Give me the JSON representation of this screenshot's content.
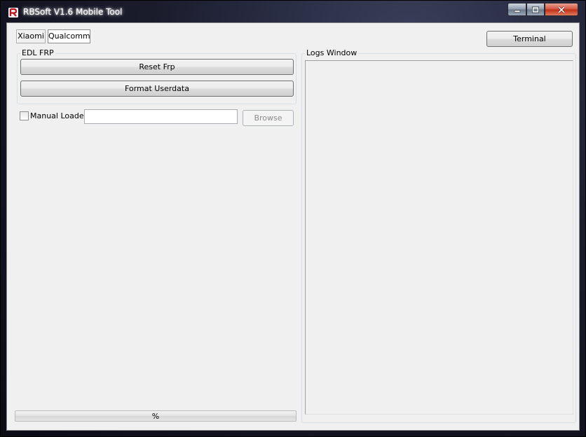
{
  "window": {
    "title": "RBSoft V1.6 Mobile Tool",
    "icon": "rbsoft-logo-icon"
  },
  "tabs": [
    {
      "label": "Xiaomi",
      "selected": false
    },
    {
      "label": "Qualcomm",
      "selected": true
    }
  ],
  "toolbar": {
    "terminal_label": "Terminal"
  },
  "edl_frp": {
    "title": "EDL FRP",
    "reset_label": "Reset Frp",
    "format_label": "Format Userdata"
  },
  "manual_loader": {
    "label": "Manual Loader",
    "checked": false,
    "path_value": "",
    "browse_label": "Browse",
    "browse_enabled": false
  },
  "logs": {
    "title": "Logs Window",
    "content": ""
  },
  "progress": {
    "label": "%",
    "value": 0
  },
  "colors": {
    "progress_fill": "#06b025",
    "close_button": "#c7391e"
  }
}
